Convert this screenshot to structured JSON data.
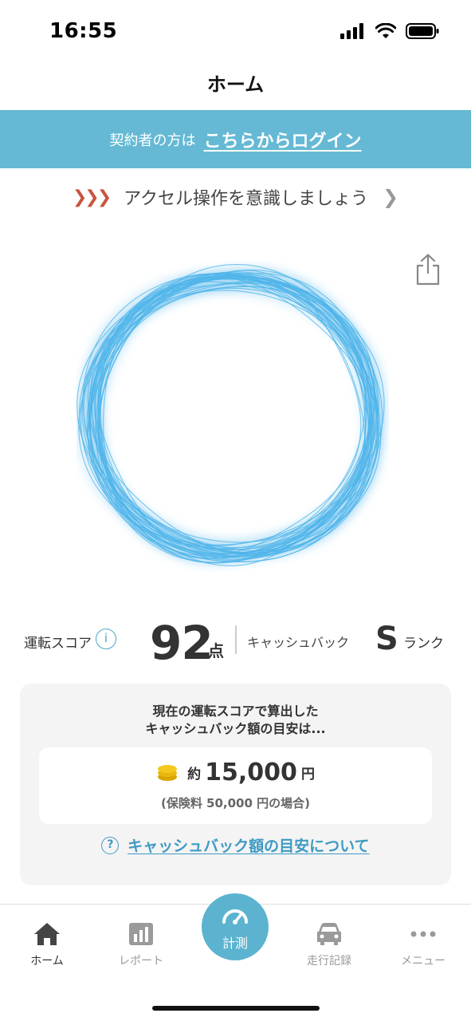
{
  "status_bar": {
    "time": "16:55"
  },
  "header": {
    "title": "ホーム"
  },
  "login_banner": {
    "prefix": "契約者の方は",
    "link_label": "こちらからログイン"
  },
  "tip": {
    "text": "アクセル操作を意識しましょう"
  },
  "score": {
    "label": "運転スコア",
    "value": "92",
    "unit": "点",
    "cashback_label": "キャッシュバック",
    "rank": "S",
    "rank_unit": "ランク"
  },
  "cashback_card": {
    "heading_line1": "現在の運転スコアで算出した",
    "heading_line2": "キャッシュバック額の目安は...",
    "prefix": "約",
    "amount": "15,000",
    "unit": "円",
    "note": "(保険料 50,000 円の場合)",
    "about_link": "キャッシュバック額の目安について"
  },
  "tabs": [
    {
      "label": "ホーム",
      "icon": "home-icon",
      "active": true
    },
    {
      "label": "レポート",
      "icon": "bar-chart-icon",
      "active": false
    },
    {
      "label": "計測",
      "icon": "speedometer-icon",
      "active": false
    },
    {
      "label": "走行記録",
      "icon": "car-icon",
      "active": false
    },
    {
      "label": "メニュー",
      "icon": "more-icon",
      "active": false
    }
  ],
  "colors": {
    "accent": "#65b9d4",
    "ring": "#4fb4ea",
    "tip_arrow": "#c9543f"
  }
}
